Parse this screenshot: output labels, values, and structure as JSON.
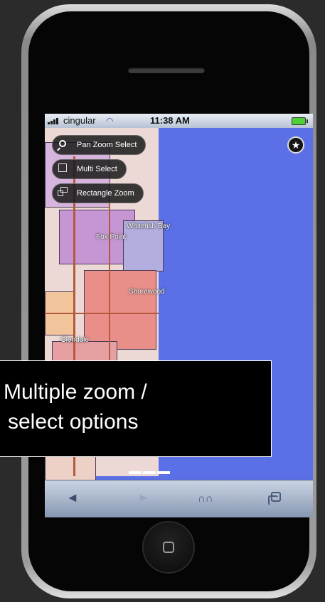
{
  "status_bar": {
    "carrier": "cingular",
    "time": "11:38 AM"
  },
  "map": {
    "labels": [
      "Whitefish Bay",
      "Fox Point",
      "Shorewood",
      "Glendale"
    ]
  },
  "tools": [
    {
      "label": "Pan Zoom Select",
      "icon": "magnifier-icon"
    },
    {
      "label": "Multi Select",
      "icon": "square-icon"
    },
    {
      "label": "Rectangle Zoom",
      "icon": "rectangle-zoom-icon"
    }
  ],
  "favorite_icon": "★",
  "callout": {
    "line1": "Multiple zoom /",
    "line2": "select options"
  },
  "toolbar": {
    "back": "◄",
    "forward": "►",
    "bookmarks": "📖"
  },
  "colors": {
    "water": "#5b6fe6",
    "district_pink": "#ea8e8a",
    "district_purple": "#c596d3"
  }
}
